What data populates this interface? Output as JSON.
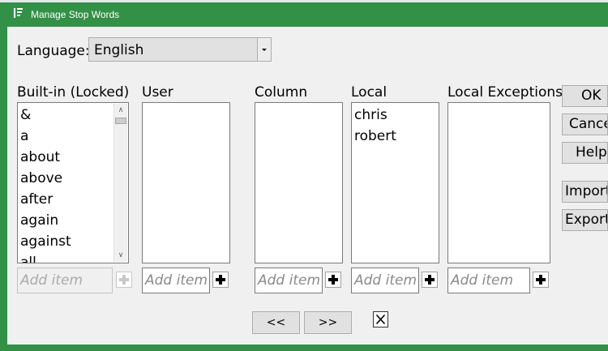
{
  "window": {
    "title": "Manage Stop Words"
  },
  "language": {
    "label": "Language:",
    "value": "English"
  },
  "columns": {
    "builtin": {
      "header": "Built-in (Locked)",
      "items": [
        "&",
        "a",
        "about",
        "above",
        "after",
        "again",
        "against",
        "all"
      ],
      "add_placeholder": "Add item"
    },
    "user": {
      "header": "User",
      "items": [],
      "add_placeholder": "Add item"
    },
    "column": {
      "header": "Column",
      "items": [],
      "add_placeholder": "Add item"
    },
    "local": {
      "header": "Local",
      "items": [
        "chris",
        "robert"
      ],
      "add_placeholder": "Add item"
    },
    "local_exceptions": {
      "header": "Local Exceptions",
      "items": [],
      "add_placeholder": "Add item"
    }
  },
  "buttons": {
    "ok": "OK",
    "cancel": "Cancel",
    "help": "Help",
    "import": "Import",
    "export": "Export"
  },
  "nav": {
    "prev": "<<",
    "next": ">>"
  },
  "colors": {
    "titlebar": "#329147",
    "client": "#f0f0f0"
  }
}
